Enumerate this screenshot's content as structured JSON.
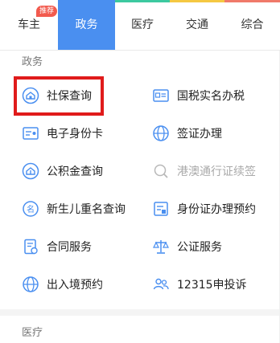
{
  "tabs": [
    {
      "label": "车主",
      "badge": "推荐",
      "active": false,
      "line_color": "#ffffff"
    },
    {
      "label": "政务",
      "active": true,
      "line_color": "#4a8ff0"
    },
    {
      "label": "医疗",
      "active": false,
      "line_color": "#3cc9a0"
    },
    {
      "label": "交通",
      "active": false,
      "line_color": "#f5c842"
    },
    {
      "label": "综合",
      "active": false,
      "line_color": "#f07a6a"
    }
  ],
  "sections": {
    "zhengwu": {
      "title": "政务"
    },
    "yiliao": {
      "title": "医疗"
    }
  },
  "items": [
    {
      "label": "社保查询",
      "icon": "house-shield-icon",
      "highlighted": true
    },
    {
      "label": "国税实名办税",
      "icon": "tax-id-card-icon"
    },
    {
      "label": "电子身份卡",
      "icon": "id-card-icon"
    },
    {
      "label": "签证办理",
      "icon": "globe-icon"
    },
    {
      "label": "公积金查询",
      "icon": "house-fund-icon"
    },
    {
      "label": "港澳通行证续签",
      "icon": "search-icon",
      "disabled": true
    },
    {
      "label": "新生儿重名查询",
      "icon": "name-tag-icon"
    },
    {
      "label": "身份证办理预约",
      "icon": "id-appointment-icon"
    },
    {
      "label": "合同服务",
      "icon": "contract-icon"
    },
    {
      "label": "公证服务",
      "icon": "scales-icon"
    },
    {
      "label": "出入境预约",
      "icon": "globe-icon"
    },
    {
      "label": "12315申投诉",
      "icon": "people-icon"
    }
  ],
  "colors": {
    "accent": "#4a8ff0",
    "highlight": "#e01b1b",
    "badge": "#f25a4e"
  }
}
